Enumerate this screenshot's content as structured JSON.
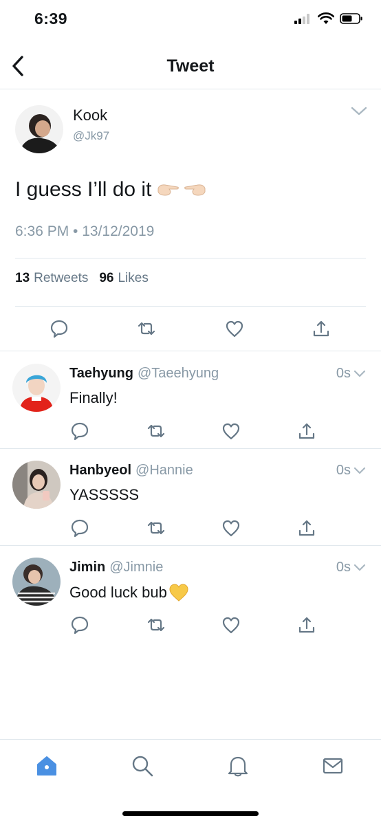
{
  "status_bar": {
    "time": "6:39"
  },
  "header": {
    "title": "Tweet"
  },
  "main_tweet": {
    "name": "Kook",
    "handle": "@Jk97",
    "text": "I guess I’ll do it",
    "emoji": "👉👉",
    "timestamp": "6:36 PM • 13/12/2019",
    "retweets_count": "13",
    "retweets_label": "Retweets",
    "likes_count": "96",
    "likes_label": "Likes"
  },
  "replies": [
    {
      "name": "Taehyung",
      "handle": "@Taeehyung",
      "time": "0s",
      "text": "Finally!",
      "emoji": ""
    },
    {
      "name": "Hanbyeol",
      "handle": "@Hannie",
      "time": "0s",
      "text": "YASSSSS",
      "emoji": ""
    },
    {
      "name": "Jimin",
      "handle": "@Jimnie",
      "time": "0s",
      "text": "Good luck bub",
      "emoji": "💛"
    }
  ],
  "tab_bar": {
    "items": [
      "home-icon",
      "search-icon",
      "notifications-icon",
      "messages-icon"
    ],
    "active": "home-icon"
  },
  "colors": {
    "accent": "#4a90e2",
    "secondary_text": "#8899a6",
    "icon": "#657786",
    "divider": "#e1e8ed"
  }
}
